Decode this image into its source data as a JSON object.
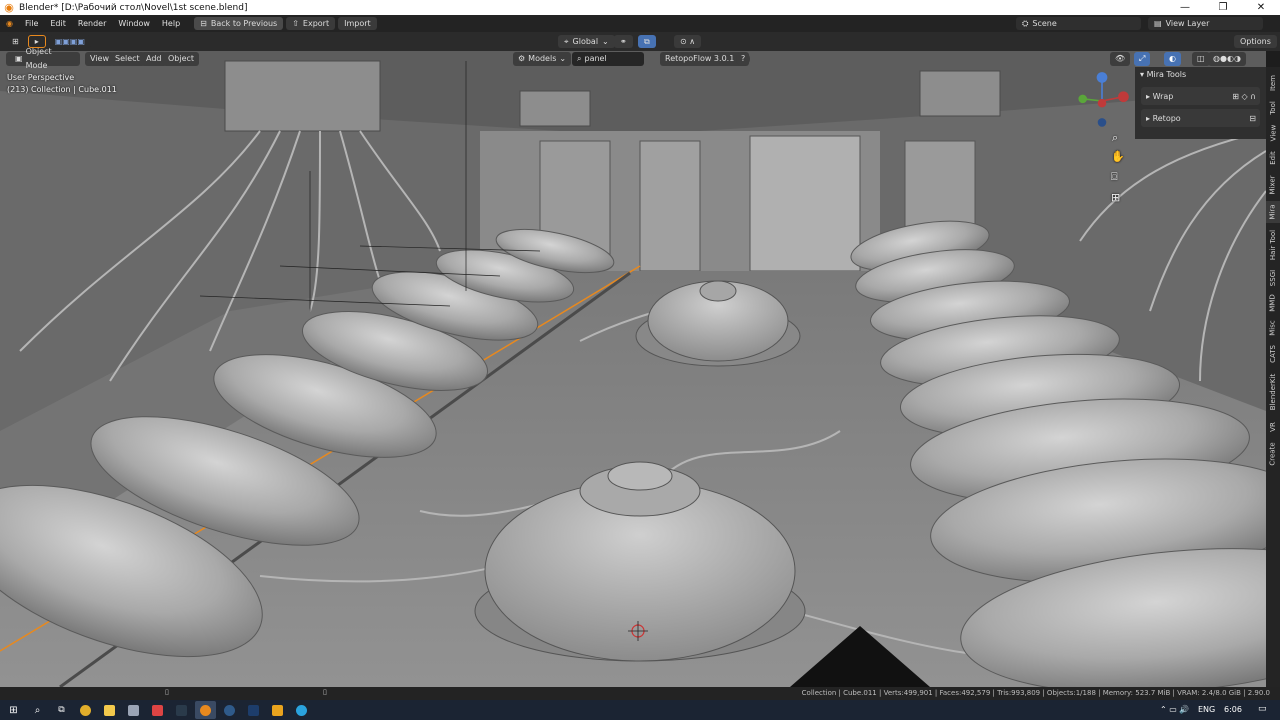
{
  "window": {
    "title": "Blender* [D:\\Рабочий стол\\Novel\\1st scene.blend]"
  },
  "menu": {
    "items": [
      "File",
      "Edit",
      "Render",
      "Window",
      "Help"
    ],
    "back_label": "Back to Previous",
    "export_label": "Export",
    "import_label": "Import",
    "scene_name": "Scene",
    "view_layer": "View Layer"
  },
  "toolbar": {
    "transform_orientation": "Global",
    "options_label": "Options"
  },
  "header": {
    "mode": "Object Mode",
    "view_label": "View",
    "select_label": "Select",
    "add_label": "Add",
    "object_label": "Object",
    "models_label": "Models",
    "search_value": "panel",
    "retopoflow_label": "RetopoFlow 3.0.1"
  },
  "viewport": {
    "perspective": "User Perspective",
    "collection_info": "(213) Collection | Cube.011"
  },
  "npanel": {
    "title": "Mira Tools",
    "wrap_label": "Wrap",
    "retopo_label": "Retopo"
  },
  "sidebar_tabs": [
    "Item",
    "Tool",
    "View",
    "Edit",
    "Mixer",
    "Mira",
    "Hair Tool",
    "SSGI",
    "MMD",
    "Misc",
    "CATS",
    "BlenderKit",
    "VR",
    "Create"
  ],
  "statusbar": {
    "stats": "Collection | Cube.011 | Verts:499,901 | Faces:492,579 | Tris:993,809 | Objects:1/188 | Memory: 523.7 MiB | VRAM: 2.4/8.0 GiB | 2.90.0"
  },
  "taskbar": {
    "language": "ENG",
    "time": "6:06"
  },
  "colors": {
    "accent": "#4772b3",
    "selection_orange": "#e8891e",
    "viewport_bg": "#6f6f6f"
  }
}
